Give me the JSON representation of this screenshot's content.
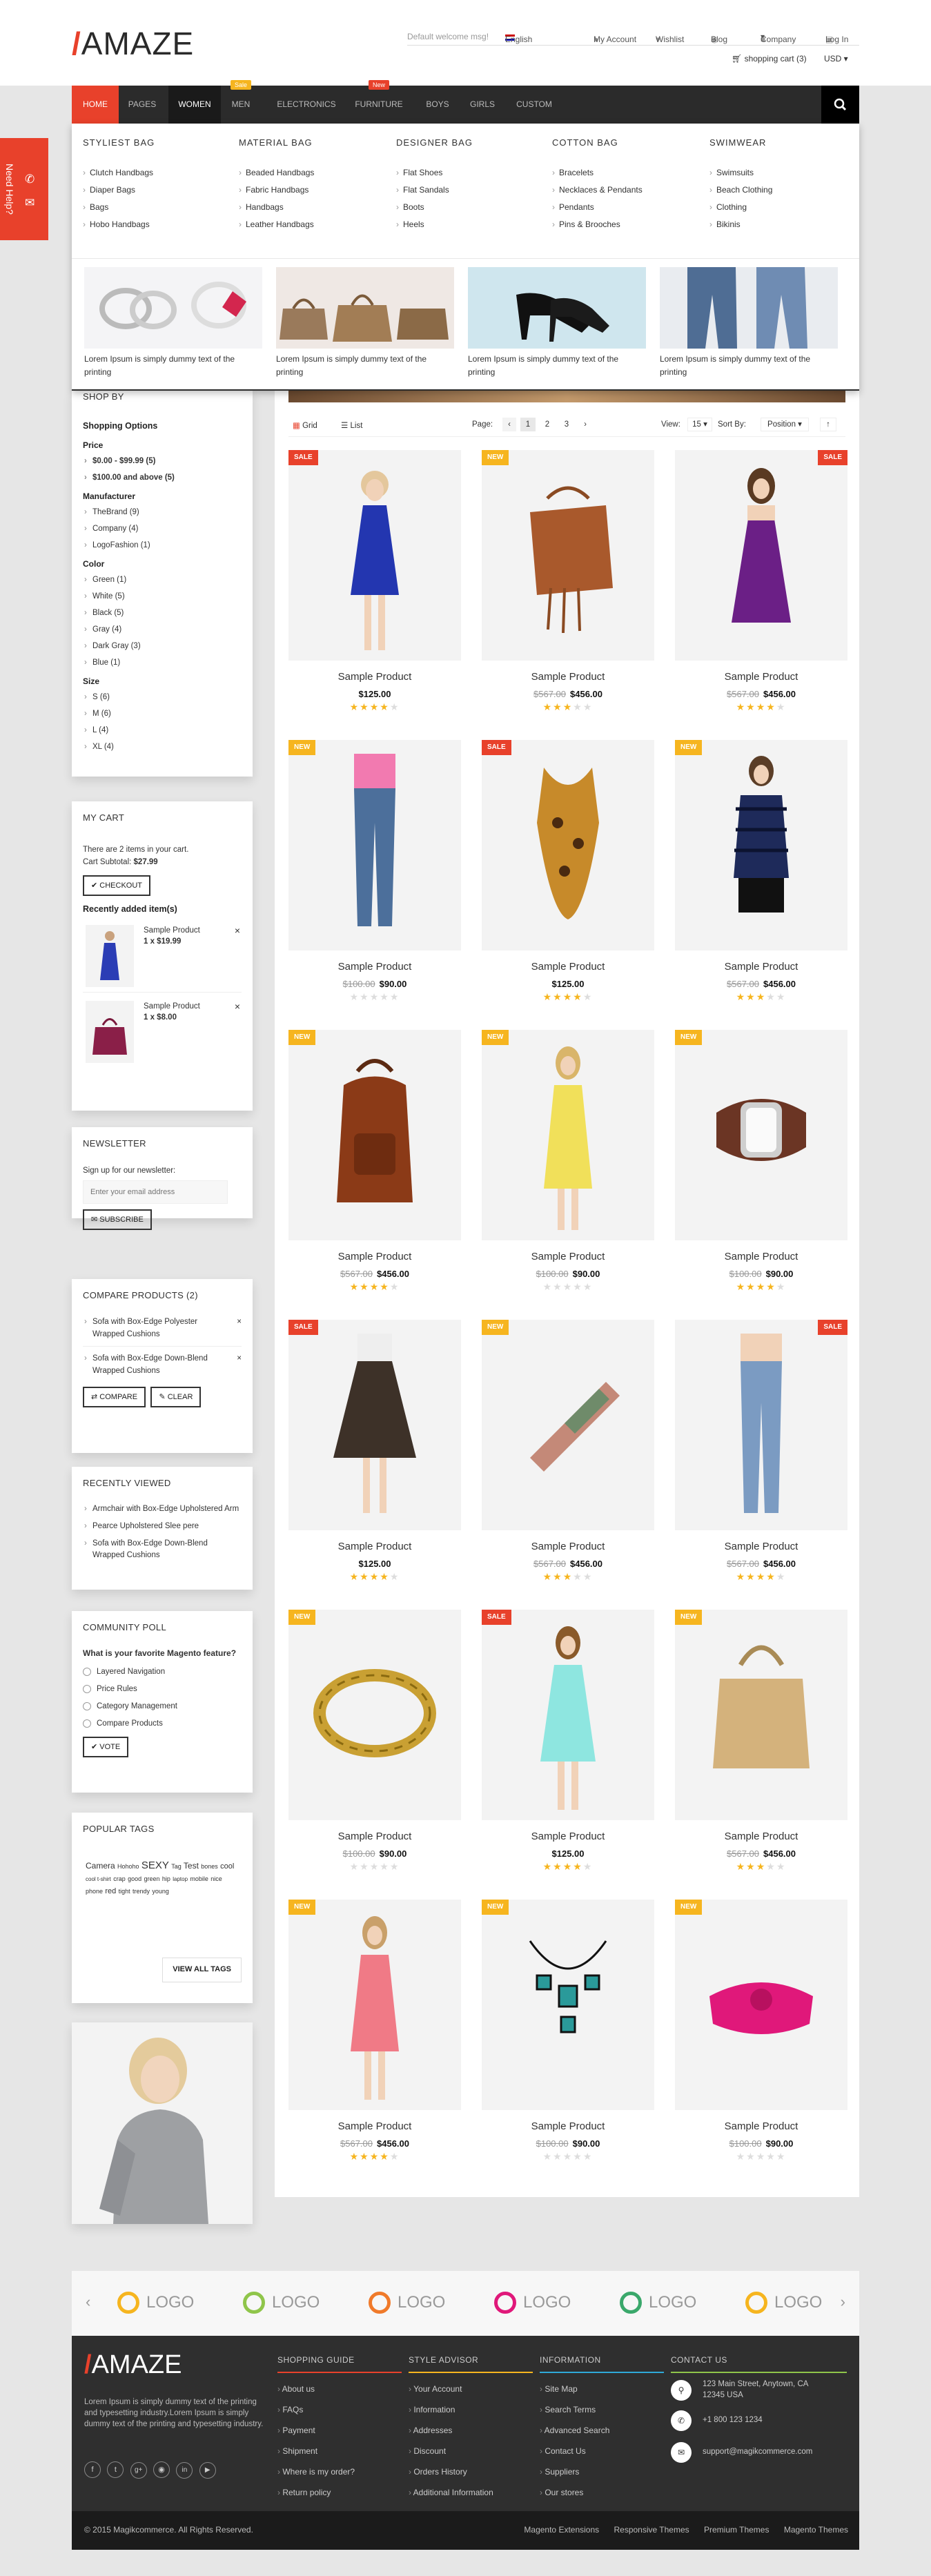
{
  "header": {
    "welcome": "Default welcome msg!",
    "language": "English",
    "my_account": "My Account",
    "wishlist": "Wishlist",
    "blog": "Blog",
    "company": "Company",
    "login": "Log In",
    "cart": "shopping cart (3)",
    "currency": "USD"
  },
  "logo": {
    "slash": "/",
    "text": "AMAZE"
  },
  "nav": {
    "items": [
      "HOME",
      "PAGES",
      "WOMEN",
      "MEN",
      "ELECTRONICS",
      "FURNITURE",
      "BOYS",
      "GIRLS",
      "CUSTOM"
    ],
    "men_badge": "Sale",
    "furniture_badge": "New"
  },
  "help": {
    "label": "Need Help?"
  },
  "mega": {
    "columns": [
      {
        "title": "STYLIEST BAG",
        "items": [
          "Clutch Handbags",
          "Diaper Bags",
          "Bags",
          "Hobo Handbags"
        ]
      },
      {
        "title": "MATERIAL BAG",
        "items": [
          "Beaded Handbags",
          "Fabric Handbags",
          "Handbags",
          "Leather Handbags"
        ]
      },
      {
        "title": "DESIGNER BAG",
        "items": [
          "Flat Shoes",
          "Flat Sandals",
          "Boots",
          "Heels"
        ]
      },
      {
        "title": "COTTON BAG",
        "items": [
          "Bracelets",
          "Necklaces & Pendants",
          "Pendants",
          "Pins & Brooches"
        ]
      },
      {
        "title": "SWIMWEAR",
        "items": [
          "Swimsuits",
          "Beach Clothing",
          "Clothing",
          "Bikinis"
        ]
      }
    ],
    "caption": "Lorem Ipsum is simply dummy text of the printing"
  },
  "shopby": {
    "title": "SHOP BY",
    "options": "Shopping Options",
    "price_label": "Price",
    "prices": [
      "$0.00 - $99.99 (5)",
      "$100.00 and above (5)"
    ],
    "manufacturer_label": "Manufacturer",
    "manufacturers": [
      "TheBrand (9)",
      "Company (4)",
      "LogoFashion (1)"
    ],
    "color_label": "Color",
    "colors": [
      "Green (1)",
      "White (5)",
      "Black (5)",
      "Gray (4)",
      "Dark Gray (3)",
      "Blue (1)"
    ],
    "size_label": "Size",
    "sizes": [
      "S (6)",
      "M (6)",
      "L (4)",
      "XL (4)"
    ]
  },
  "cart": {
    "title": "MY CART",
    "summary": "There are 2 items in your cart.",
    "subtotal_label": "Cart Subtotal:",
    "subtotal": "$27.99",
    "checkout": "CHECKOUT",
    "recent": "Recently added item(s)",
    "items": [
      {
        "name": "Sample Product",
        "qty": "1 x $19.99"
      },
      {
        "name": "Sample Product",
        "qty": "1 x $8.00"
      }
    ]
  },
  "newsletter": {
    "title": "NEWSLETTER",
    "text": "Sign up for our newsletter:",
    "placeholder": "Enter your email address",
    "button": "SUBSCRIBE"
  },
  "compare": {
    "title": "COMPARE PRODUCTS (2)",
    "items": [
      "Sofa with Box-Edge Polyester Wrapped Cushions",
      "Sofa with Box-Edge Down-Blend Wrapped Cushions"
    ],
    "compare_btn": "COMPARE",
    "clear_btn": "CLEAR"
  },
  "recent": {
    "title": "RECENTLY VIEWED",
    "items": [
      "Armchair with Box-Edge Upholstered Arm",
      "Pearce Upholstered Slee pere",
      "Sofa with Box-Edge Down-Blend Wrapped Cushions"
    ]
  },
  "poll": {
    "title": "COMMUNITY POLL",
    "question": "What is your favorite Magento feature?",
    "options": [
      "Layered Navigation",
      "Price Rules",
      "Category Management",
      "Compare Products"
    ],
    "vote": "VOTE"
  },
  "tags": {
    "title": "POPULAR TAGS",
    "items": [
      "Camera",
      "Hohoho",
      "SEXY",
      "Tag",
      "Test",
      "bones",
      "cool",
      "cool t-shirt",
      "crap",
      "good",
      "green",
      "hip",
      "laptop",
      "mobile",
      "nice",
      "phone",
      "red",
      "tight",
      "trendy",
      "young"
    ],
    "view_all": "VIEW ALL TAGS"
  },
  "toolbar": {
    "grid": "Grid",
    "list": "List",
    "page_label": "Page:",
    "pages": [
      "1",
      "2",
      "3"
    ],
    "view_label": "View:",
    "view_value": "15",
    "sort_label": "Sort By:",
    "sort_value": "Position"
  },
  "products": [
    {
      "name": "Sample Product",
      "price": "$125.00",
      "old": "",
      "badge": "SALE",
      "rating": 4,
      "img": "dress-blue"
    },
    {
      "name": "Sample Product",
      "price": "$456.00",
      "old": "$567.00",
      "badge": "NEW",
      "rating": 3,
      "img": "bag-brown"
    },
    {
      "name": "Sample Product",
      "price": "$456.00",
      "old": "$567.00",
      "badge": "SALE",
      "rating": 4,
      "img": "dress-purple"
    },
    {
      "name": "Sample Product",
      "price": "$90.00",
      "old": "$100.00",
      "badge": "NEW",
      "rating": 0,
      "img": "jeans"
    },
    {
      "name": "Sample Product",
      "price": "$125.00",
      "old": "",
      "badge": "SALE",
      "rating": 4,
      "img": "scarf"
    },
    {
      "name": "Sample Product",
      "price": "$456.00",
      "old": "$567.00",
      "badge": "NEW",
      "rating": 3,
      "img": "top-stripe"
    },
    {
      "name": "Sample Product",
      "price": "$456.00",
      "old": "$567.00",
      "badge": "NEW",
      "rating": 4,
      "img": "backpack"
    },
    {
      "name": "Sample Product",
      "price": "$90.00",
      "old": "$100.00",
      "badge": "NEW",
      "rating": 0,
      "img": "dress-yellow"
    },
    {
      "name": "Sample Product",
      "price": "$90.00",
      "old": "$100.00",
      "badge": "NEW",
      "rating": 4,
      "img": "watch"
    },
    {
      "name": "Sample Product",
      "price": "$125.00",
      "old": "",
      "badge": "SALE",
      "rating": 4,
      "img": "skirt"
    },
    {
      "name": "Sample Product",
      "price": "$456.00",
      "old": "$567.00",
      "badge": "NEW",
      "rating": 3,
      "img": "wallet"
    },
    {
      "name": "Sample Product",
      "price": "$456.00",
      "old": "$567.00",
      "badge": "SALE",
      "rating": 4,
      "img": "jeans-light"
    },
    {
      "name": "Sample Product",
      "price": "$90.00",
      "old": "$100.00",
      "badge": "NEW",
      "rating": 0,
      "img": "bracelet"
    },
    {
      "name": "Sample Product",
      "price": "$125.00",
      "old": "",
      "badge": "SALE",
      "rating": 4,
      "img": "dress-mint"
    },
    {
      "name": "Sample Product",
      "price": "$456.00",
      "old": "$567.00",
      "badge": "NEW",
      "rating": 3,
      "img": "bag-beige"
    },
    {
      "name": "Sample Product",
      "price": "$456.00",
      "old": "$567.00",
      "badge": "NEW",
      "rating": 4,
      "img": "dress-coral"
    },
    {
      "name": "Sample Product",
      "price": "$90.00",
      "old": "$100.00",
      "badge": "NEW",
      "rating": 0,
      "img": "necklace"
    },
    {
      "name": "Sample Product",
      "price": "$90.00",
      "old": "$100.00",
      "badge": "NEW",
      "rating": 0,
      "img": "clutch-pink"
    }
  ],
  "brands": [
    "LOGO",
    "LOGO",
    "LOGO",
    "LOGO",
    "LOGO",
    "LOGO"
  ],
  "footer": {
    "about": "Lorem Ipsum is simply dummy text of the printing and typesetting industry.Lorem Ipsum is simply dummy text of the printing and typesetting industry.",
    "columns": [
      {
        "title": "SHOPPING GUIDE",
        "color": "#e8412b",
        "items": [
          "About us",
          "FAQs",
          "Payment",
          "Shipment",
          "Where is my order?",
          "Return policy"
        ]
      },
      {
        "title": "STYLE ADVISOR",
        "color": "#f6b51f",
        "items": [
          "Your Account",
          "Information",
          "Addresses",
          "Discount",
          "Orders History",
          "Additional Information"
        ]
      },
      {
        "title": "INFORMATION",
        "color": "#2fa9d8",
        "items": [
          "Site Map",
          "Search Terms",
          "Advanced Search",
          "Contact Us",
          "Suppliers",
          "Our stores"
        ]
      }
    ],
    "contact_title": "CONTACT US",
    "contact_color": "#8fc54a",
    "address": "123 Main Street, Anytown, CA 12345 USA",
    "phone": "+1 800 123 1234",
    "email": "support@magikcommerce.com",
    "copyright": "© 2015 Magikcommerce. All Rights Reserved.",
    "links": [
      "Magento Extensions",
      "Responsive Themes",
      "Premium Themes",
      "Magento Themes"
    ]
  },
  "colors": {
    "accent": "#e8412b",
    "badge_new": "#f6b51f",
    "star": "#f6b51f",
    "dark": "#2b2b2b"
  }
}
